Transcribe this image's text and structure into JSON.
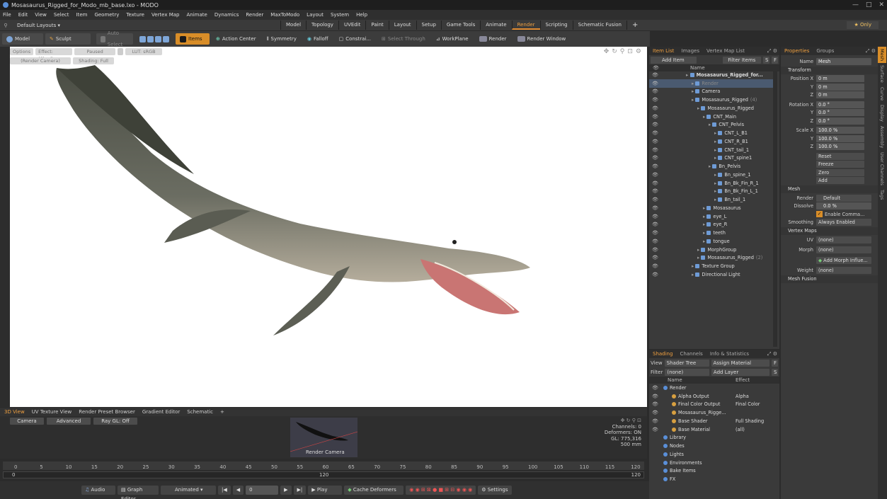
{
  "window": {
    "title": "Mosasaurus_Rigged_for_Modo_mb_base.lxo - MODO",
    "min": "—",
    "max": "□",
    "close": "✕"
  },
  "menu": [
    "File",
    "Edit",
    "View",
    "Select",
    "Item",
    "Geometry",
    "Texture",
    "Vertex Map",
    "Animate",
    "Dynamics",
    "Render",
    "MaxToModo",
    "Layout",
    "System",
    "Help"
  ],
  "layouts": {
    "label": "Default Layouts ▾",
    "tabs": [
      "Model",
      "Topology",
      "UVEdit",
      "Paint",
      "Layout",
      "Setup",
      "Game Tools",
      "Animate",
      "Render",
      "Scripting",
      "Schematic Fusion"
    ],
    "active": "Render",
    "add": "+",
    "only": "★ Only"
  },
  "toolbar": {
    "model": "Model",
    "sculpt": "Sculpt",
    "auto_select": "Auto Select",
    "items": "Items",
    "action_center": "Action Center",
    "symmetry": "Symmetry",
    "falloff": "Falloff",
    "constrain": "Constrai...",
    "select_through": "Select Through",
    "workplane": "WorkPlane",
    "render": "Render",
    "render_window": "Render Window"
  },
  "viewport": {
    "options": "Options",
    "effect": "Effect: (Shadi...",
    "paused": "Paused",
    "lut": "LUT: sRGB",
    "camera": "(Render Camera)",
    "shading": "Shading: Full"
  },
  "bottom_tabs": [
    "3D View",
    "UV Texture View",
    "Render Preset Browser",
    "Gradient Editor",
    "Schematic"
  ],
  "bottom_panel": {
    "camera": "Camera",
    "advanced": "Advanced",
    "raygl": "Ray GL: Off",
    "thumb_label": "Render Camera",
    "stats": [
      "Channels: 0",
      "Deformers: ON",
      "GL: 775,316",
      "500 mm"
    ]
  },
  "timeline": {
    "ticks": [
      "0",
      "5",
      "10",
      "15",
      "20",
      "25",
      "30",
      "35",
      "40",
      "45",
      "50",
      "55",
      "60",
      "65",
      "70",
      "75",
      "80",
      "85",
      "90",
      "95",
      "100",
      "105",
      "110",
      "115",
      "120"
    ],
    "start": "0",
    "mid": "120",
    "end": "120"
  },
  "playbar": {
    "audio": "Audio",
    "graph_editor": "Graph Editor",
    "animated": "Animated",
    "frame": "0",
    "play": "Play",
    "cache": "Cache Deformers",
    "settings": "Settings"
  },
  "item_list": {
    "tabs": [
      "Item List",
      "Images",
      "Vertex Map List"
    ],
    "add_item": "Add Item",
    "filter_items": "Filter Items",
    "col_name": "Name",
    "rows": [
      {
        "label": "Mosasaurus_Rigged_for...",
        "indent": 0,
        "bold": true
      },
      {
        "label": "Render",
        "indent": 1,
        "selected": true
      },
      {
        "label": "Camera",
        "indent": 1
      },
      {
        "label": "Mosasaurus_Rigged",
        "suffix": "(4)",
        "indent": 1
      },
      {
        "label": "Mosasaurus_Rigged",
        "indent": 2
      },
      {
        "label": "CNT_Main",
        "indent": 3
      },
      {
        "label": "CNT_Pelvis",
        "indent": 4
      },
      {
        "label": "CNT_L_B1",
        "indent": 5
      },
      {
        "label": "CNT_R_B1",
        "indent": 5
      },
      {
        "label": "CNT_tail_1",
        "indent": 5
      },
      {
        "label": "CNT_spine1",
        "indent": 5
      },
      {
        "label": "Bn_Pelvis",
        "indent": 4
      },
      {
        "label": "Bn_spine_1",
        "indent": 5
      },
      {
        "label": "Bn_Bk_Fin_R_1",
        "indent": 5
      },
      {
        "label": "Bn_Bk_Fin_L_1",
        "indent": 5
      },
      {
        "label": "Bn_tail_1",
        "indent": 5
      },
      {
        "label": "Mosasaurus",
        "indent": 3
      },
      {
        "label": "eye_L",
        "indent": 3
      },
      {
        "label": "eye_R",
        "indent": 3
      },
      {
        "label": "teeth",
        "indent": 3
      },
      {
        "label": "tongue",
        "indent": 3
      },
      {
        "label": "MorphGroup",
        "indent": 2
      },
      {
        "label": "Mosasaurus_Rigged",
        "suffix": "(2)",
        "indent": 2
      },
      {
        "label": "Texture Group",
        "indent": 1
      },
      {
        "label": "Directional Light",
        "indent": 1
      }
    ]
  },
  "properties": {
    "tabs": [
      "Properties",
      "Groups"
    ],
    "name_label": "Name",
    "name_value": "Mesh",
    "transform": "Transform",
    "position": [
      {
        "axis": "Position X",
        "value": "0 m"
      },
      {
        "axis": "Y",
        "value": "0 m"
      },
      {
        "axis": "Z",
        "value": "0 m"
      }
    ],
    "rotation": [
      {
        "axis": "Rotation X",
        "value": "0.0 °"
      },
      {
        "axis": "Y",
        "value": "0.0 °"
      },
      {
        "axis": "Z",
        "value": "0.0 °"
      }
    ],
    "scale": [
      {
        "axis": "Scale X",
        "value": "100.0 %"
      },
      {
        "axis": "Y",
        "value": "100.0 %"
      },
      {
        "axis": "Z",
        "value": "100.0 %"
      }
    ],
    "actions": [
      "Reset",
      "Freeze",
      "Zero",
      "Add"
    ],
    "mesh": "Mesh",
    "render_label": "Render",
    "render_value": "Default",
    "dissolve_label": "Dissolve",
    "dissolve_value": "0.0 %",
    "enable_command": "Enable Comma...",
    "smoothing_label": "Smoothing",
    "smoothing_value": "Always Enabled",
    "vertex_maps": "Vertex Maps",
    "uv_label": "UV",
    "uv_value": "(none)",
    "morph_label": "Morph",
    "morph_value": "(none)",
    "add_morph": "Add Morph Influe...",
    "weight_label": "Weight",
    "weight_value": "(none)",
    "mesh_fusion": "Mesh Fusion",
    "side_tabs": [
      "Mesh",
      "Surface",
      "Curve",
      "Display",
      "Assembly",
      "User Channels",
      "Tags"
    ]
  },
  "shading": {
    "tabs": [
      "Shading",
      "Channels",
      "Info & Statistics"
    ],
    "view_label": "View",
    "view_value": "Shader Tree",
    "assign": "Assign Material",
    "filter_label": "Filter",
    "filter_value": "(none)",
    "add_layer": "Add Layer",
    "col_name": "Name",
    "col_effect": "Effect",
    "rows": [
      {
        "label": "Render",
        "effect": "",
        "indent": 0
      },
      {
        "label": "Alpha Output",
        "effect": "Alpha",
        "indent": 1
      },
      {
        "label": "Final Color Output",
        "effect": "Final Color",
        "indent": 1
      },
      {
        "label": "Mosasaurus_Rigge...",
        "effect": "",
        "indent": 1
      },
      {
        "label": "Base Shader",
        "effect": "Full Shading",
        "indent": 1
      },
      {
        "label": "Base Material",
        "effect": "(all)",
        "indent": 1
      },
      {
        "label": "Library",
        "effect": "",
        "indent": 0
      },
      {
        "label": "Nodes",
        "effect": "",
        "indent": 0
      },
      {
        "label": "Lights",
        "effect": "",
        "indent": 0
      },
      {
        "label": "Environments",
        "effect": "",
        "indent": 0
      },
      {
        "label": "Bake Items",
        "effect": "",
        "indent": 0
      },
      {
        "label": "FX",
        "effect": "",
        "indent": 0
      }
    ]
  },
  "colors": {
    "accent": "#d88d28",
    "panel": "#3a3a3a",
    "viewport": "#ffffff"
  }
}
